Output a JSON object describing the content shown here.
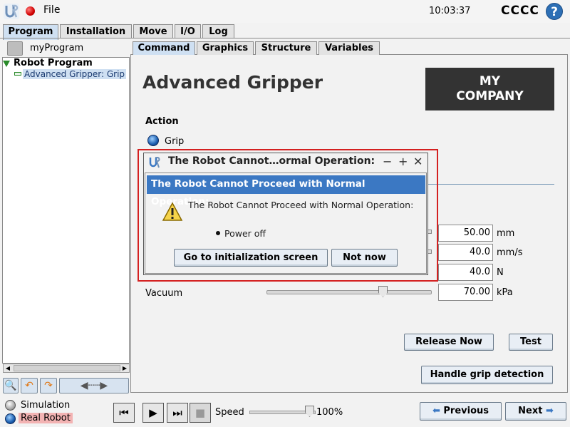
{
  "topbar": {
    "file_label": "File",
    "clock": "10:03:37",
    "robot_name": "CCCC",
    "help_glyph": "?"
  },
  "main_tabs": [
    "Program",
    "Installation",
    "Move",
    "I/O",
    "Log"
  ],
  "left": {
    "program_name": "myProgram",
    "tree_root": "Robot Program",
    "tree_item": "Advanced Gripper: Grip"
  },
  "sub_tabs": [
    "Command",
    "Graphics",
    "Structure",
    "Variables"
  ],
  "content": {
    "title": "Advanced Gripper",
    "company_line1": "MY",
    "company_line2": "COMPANY",
    "action_label": "Action",
    "grip_label": "Grip",
    "fields": [
      {
        "value": "50.00",
        "unit": "mm"
      },
      {
        "value": "40.0",
        "unit": "mm/s"
      },
      {
        "value": "40.0",
        "unit": "N"
      },
      {
        "value": "70.00",
        "unit": "kPa"
      }
    ],
    "vacuum_label": "Vacuum",
    "vacuum_level": 0.7,
    "release_button": "Release Now",
    "test_button": "Test",
    "handle_button": "Handle grip detection"
  },
  "dialog": {
    "window_title": "The Robot Cannot…ormal Operation:",
    "header": "The Robot Cannot Proceed with Normal Operation:",
    "message": "The Robot Cannot Proceed with Normal Operation:",
    "bullet": "Power off",
    "primary_button": "Go to initialization screen",
    "secondary_button": "Not now",
    "minimize": "−",
    "maximize": "+",
    "close": "✕"
  },
  "bottom": {
    "simulation_label": "Simulation",
    "real_robot_label": "Real Robot",
    "speed_label": "Speed",
    "speed_value": "100%",
    "previous_button": "Previous",
    "next_button": "Next"
  },
  "colors": {
    "accent": "#3b78c3",
    "highlight_border": "#d42020",
    "company_bg": "#333333"
  }
}
